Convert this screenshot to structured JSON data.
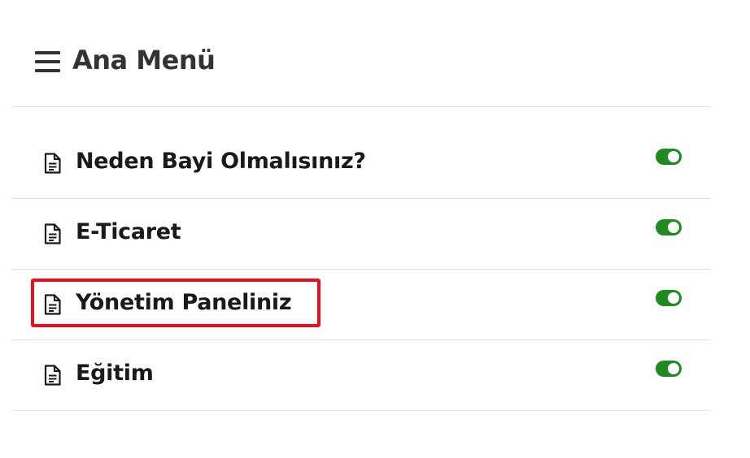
{
  "header": {
    "title": "Ana Menü",
    "menu_icon": "hamburger-icon"
  },
  "menu": {
    "items": [
      {
        "label": "Neden Bayi Olmalısınız?",
        "icon": "document-icon",
        "enabled": true
      },
      {
        "label": "E-Ticaret",
        "icon": "document-icon",
        "enabled": true
      },
      {
        "label": "Yönetim Paneliniz",
        "icon": "document-icon",
        "enabled": true,
        "highlighted": true
      },
      {
        "label": "Eğitim",
        "icon": "document-icon",
        "enabled": true
      }
    ]
  },
  "colors": {
    "toggle_on": "#1f8a1f",
    "highlight": "#e8101a",
    "title": "#333333"
  }
}
